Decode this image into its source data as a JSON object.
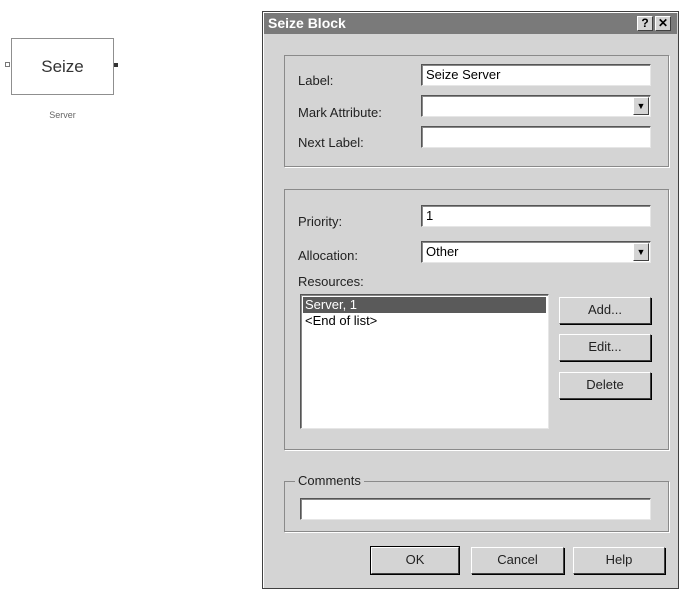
{
  "canvas_block": {
    "name": "Seize",
    "caption": "Server"
  },
  "dialog": {
    "title": "Seize Block",
    "help_button": "?",
    "close_button": "✕",
    "label": {
      "label": "Label:",
      "value": "Seize Server"
    },
    "mark_attribute": {
      "label": "Mark Attribute:",
      "value": ""
    },
    "next_label": {
      "label": "Next Label:",
      "value": ""
    },
    "priority": {
      "label": "Priority:",
      "value": "1"
    },
    "allocation": {
      "label": "Allocation:",
      "value": "Other"
    },
    "resources": {
      "label": "Resources:",
      "items": [
        "Server, 1",
        "<End of list>"
      ],
      "selected_index": 0
    },
    "buttons": {
      "add": "Add...",
      "edit": "Edit...",
      "delete": "Delete"
    },
    "comments": {
      "label": "Comments",
      "value": ""
    },
    "footer": {
      "ok": "OK",
      "cancel": "Cancel",
      "help": "Help"
    }
  },
  "icons": {
    "dropdown": "chevron-down-icon"
  }
}
